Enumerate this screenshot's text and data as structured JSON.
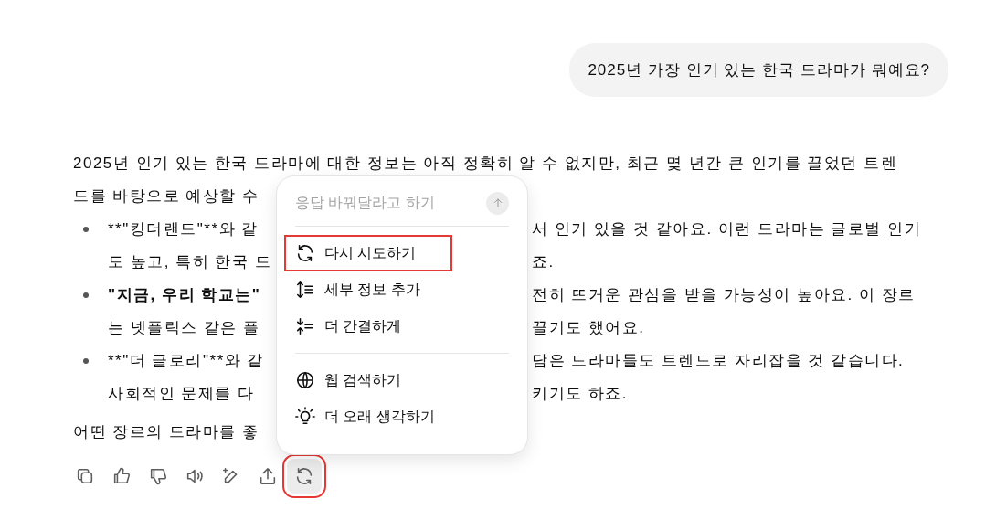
{
  "user_message": {
    "text": "2025년 가장 인기 있는 한국 드라마가 뭐예요?"
  },
  "answer": {
    "lines": [
      {
        "kind": "text",
        "left": {
          "text": "2025년 인기 있는 한국 드라마에 대한 정보는 아직 정확히 알 수 없지만, 최근 몇 년간 큰 인기를 끌었던 트렌",
          "bold": false
        }
      },
      {
        "kind": "text",
        "left": {
          "text": "드를 바탕으로 예상할 수",
          "bold": false
        }
      },
      {
        "kind": "bullet",
        "left": {
          "text": "**\"킹더랜드\"**와 같",
          "bold": false
        },
        "right": "서 인기 있을 것 같아요. 이런 드라마는 글로벌 인기"
      },
      {
        "kind": "continuation",
        "left": {
          "text": "도 높고, 특히 한국 드",
          "bold": false
        },
        "right": "죠."
      },
      {
        "kind": "bullet",
        "left": {
          "text": "\"지금, 우리 학교는\"",
          "bold": true
        },
        "right": "전히 뜨거운 관심을 받을 가능성이 높아요. 이 장르"
      },
      {
        "kind": "continuation",
        "left": {
          "text": "는 넷플릭스 같은 플",
          "bold": false
        },
        "right": "끌기도 했어요."
      },
      {
        "kind": "bullet",
        "left": {
          "text": "**\"더 글로리\"**와 같",
          "bold": false
        },
        "right": "담은 드라마들도 트렌드로 자리잡을 것 같습니다."
      },
      {
        "kind": "continuation",
        "left": {
          "text": "사회적인 문제를 다",
          "bold": false
        },
        "right": "키기도 하죠."
      },
      {
        "kind": "closing",
        "left": {
          "text": "어떤 장르의 드라마를 좋",
          "bold": false
        }
      }
    ]
  },
  "menu": {
    "input": {
      "placeholder": "응답 바꿔달라고 하기"
    },
    "groups": [
      [
        {
          "kind": "retry",
          "label": "다시 시도하기",
          "highlighted": true
        },
        {
          "kind": "add-detail",
          "label": "세부 정보 추가",
          "highlighted": false
        },
        {
          "kind": "concise",
          "label": "더 간결하게",
          "highlighted": false
        }
      ],
      [
        {
          "kind": "web",
          "label": "웹 검색하기",
          "highlighted": false
        },
        {
          "kind": "think",
          "label": "더 오래 생각하기",
          "highlighted": false
        }
      ]
    ]
  },
  "actions": [
    {
      "kind": "copy",
      "selected": false,
      "highlighted": false
    },
    {
      "kind": "like",
      "selected": false,
      "highlighted": false
    },
    {
      "kind": "dislike",
      "selected": false,
      "highlighted": false
    },
    {
      "kind": "read-aloud",
      "selected": false,
      "highlighted": false
    },
    {
      "kind": "edit",
      "selected": false,
      "highlighted": false
    },
    {
      "kind": "share",
      "selected": false,
      "highlighted": false
    },
    {
      "kind": "regenerate",
      "selected": true,
      "highlighted": true
    }
  ]
}
